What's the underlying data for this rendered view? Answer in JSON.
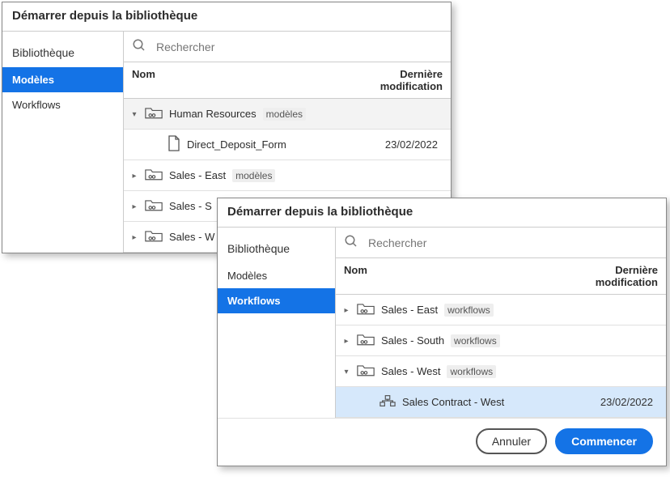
{
  "panel1": {
    "title": "Démarrer depuis la bibliothèque",
    "search_placeholder": "Rechercher",
    "sidebar_heading": "Bibliothèque",
    "sidebar": {
      "models": "Modèles",
      "workflows": "Workflows"
    },
    "columns": {
      "name": "Nom",
      "modified": "Dernière modification"
    },
    "rows": {
      "hr_name": "Human Resources",
      "hr_suffix": "modèles",
      "dd_name": "Direct_Deposit_Form",
      "dd_date": "23/02/2022",
      "east_name": "Sales - East",
      "east_suffix": "modèles",
      "south_name": "Sales - S",
      "west_name": "Sales - W"
    }
  },
  "panel2": {
    "title": "Démarrer depuis la bibliothèque",
    "search_placeholder": "Rechercher",
    "sidebar_heading": "Bibliothèque",
    "sidebar": {
      "models": "Modèles",
      "workflows": "Workflows"
    },
    "columns": {
      "name": "Nom",
      "modified": "Dernière modification"
    },
    "rows": {
      "east_name": "Sales - East",
      "east_suffix": "workflows",
      "south_name": "Sales - South",
      "south_suffix": "workflows",
      "west_name": "Sales - West",
      "west_suffix": "workflows",
      "contract_name": "Sales Contract - West",
      "contract_date": "23/02/2022"
    },
    "buttons": {
      "cancel": "Annuler",
      "start": "Commencer"
    }
  }
}
